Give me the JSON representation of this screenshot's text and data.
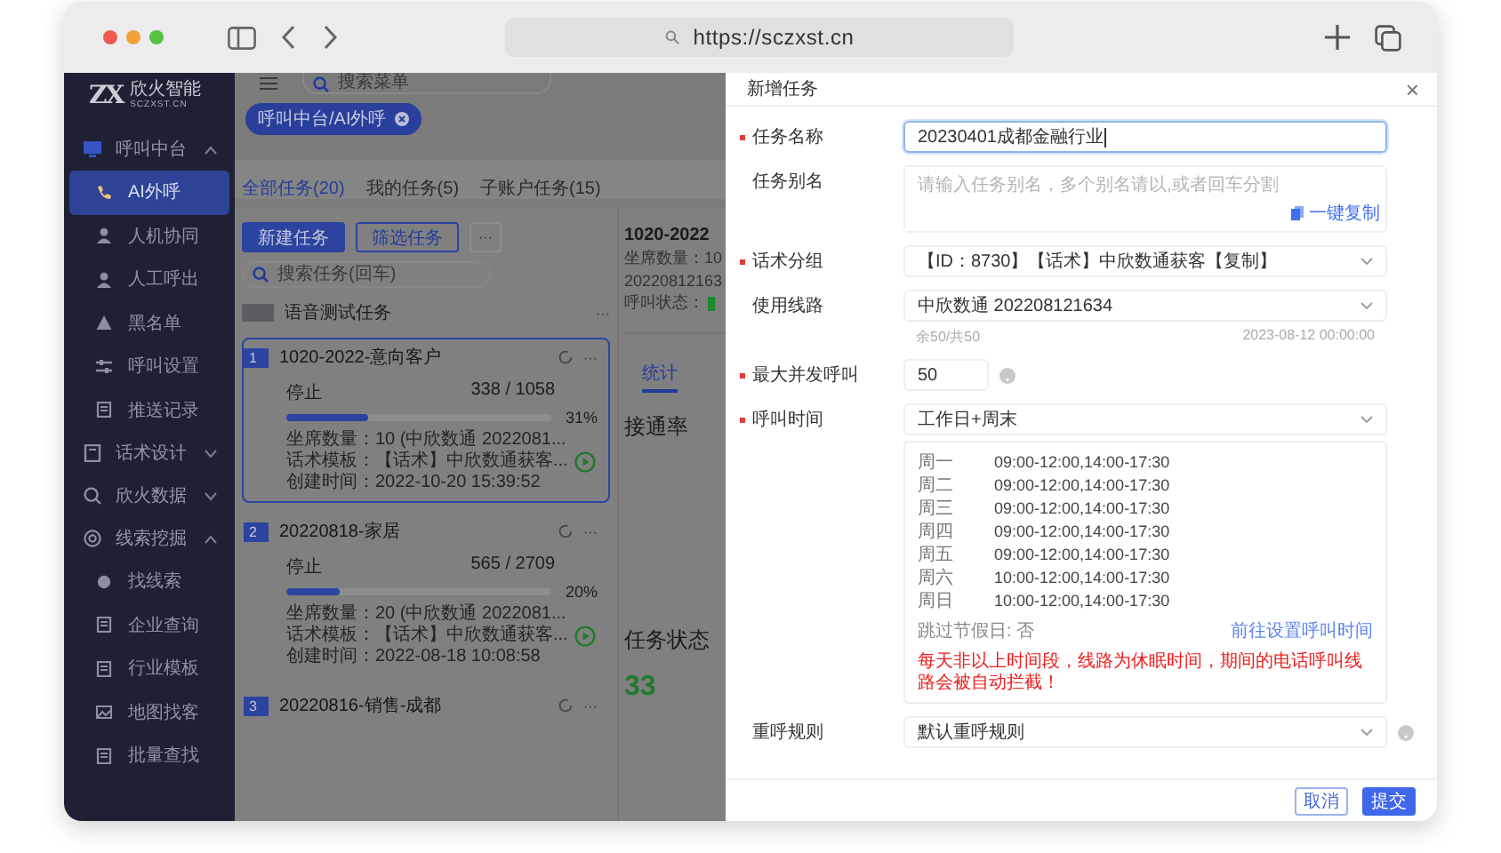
{
  "browser": {
    "url": "https://sczxst.cn"
  },
  "sidebar": {
    "logo": {
      "mark": "ZX",
      "name": "欣火智能",
      "domain": "SCZXST.CN"
    },
    "items": [
      {
        "label": "呼叫中台",
        "expanded": true,
        "children": [
          {
            "label": "AI外呼",
            "selected": true
          },
          {
            "label": "人机协同",
            "selected": false
          },
          {
            "label": "人工呼出",
            "selected": false
          },
          {
            "label": "黑名单",
            "selected": false
          },
          {
            "label": "呼叫设置",
            "selected": false
          },
          {
            "label": "推送记录",
            "selected": false
          }
        ]
      },
      {
        "label": "话术设计",
        "expanded": false
      },
      {
        "label": "欣火数据",
        "expanded": false
      },
      {
        "label": "线索挖掘",
        "expanded": true,
        "children": [
          {
            "label": "找线索",
            "selected": false
          },
          {
            "label": "企业查询",
            "selected": false
          },
          {
            "label": "行业模板",
            "selected": false
          },
          {
            "label": "地图找客",
            "selected": false
          },
          {
            "label": "批量查找",
            "selected": false
          }
        ]
      }
    ]
  },
  "topbar": {
    "search_placeholder": "搜索菜单",
    "breadcrumb_tag": "呼叫中台/AI外呼"
  },
  "tabs": [
    {
      "label": "全部任务(20)",
      "selected": true
    },
    {
      "label": "我的任务(5)",
      "selected": false
    },
    {
      "label": "子账户任务(15)",
      "selected": false
    }
  ],
  "task_list": {
    "new_button": "新建任务",
    "filter_button": "筛选任务",
    "more_button": "···",
    "search_placeholder": "搜索任务(回车)",
    "group": {
      "name": "语音测试任务",
      "more": "···"
    },
    "tasks": [
      {
        "index": "1",
        "name": "1020-2022-意向客户",
        "more": "···",
        "selected": true,
        "status": "停止",
        "count": "338 / 1058",
        "level": 0.31,
        "percent": "31%",
        "seats": "坐席数量：10 (中欣数通 2022081...",
        "script": "话术模板：【话术】中欣数通获客...",
        "created": "创建时间：2022-10-20 15:39:52"
      },
      {
        "index": "2",
        "name": "20220818-家居",
        "more": "···",
        "selected": false,
        "status": "停止",
        "count": "565 / 2709",
        "level": 0.2,
        "percent": "20%",
        "seats": "坐席数量：20 (中欣数通 2022081...",
        "script": "话术模板：【话术】中欣数通获客...",
        "created": "创建时间：2022-08-18 10:08:58"
      },
      {
        "index": "3",
        "name": "20220816-销售-成都",
        "more": "···",
        "selected": false
      }
    ]
  },
  "detail": {
    "title": "1020-2022",
    "seats": "坐席数量：10",
    "line": "20220812163",
    "call_status": "呼叫状态：",
    "tab": "统计",
    "connect_rate": "接通率",
    "task_status": "任务状态",
    "number": "33"
  },
  "dialog": {
    "title": "新增任务",
    "close": "×",
    "fields": [
      {
        "kind": "input",
        "label": "任务名称",
        "required": true,
        "value": "20230401成都金融行业"
      },
      {
        "kind": "textarea",
        "label": "任务别名",
        "required": false,
        "placeholder": "请输入任务别名，多个别名请以,或者回车分割",
        "link": "一键复制"
      },
      {
        "kind": "select",
        "label": "话术分组",
        "required": true,
        "value": "【ID：8730】【话术】中欣数通获客【复制】"
      },
      {
        "kind": "select",
        "label": "使用线路",
        "required": false,
        "value": "中欣数通 202208121634",
        "hint_left": "余50/共50",
        "hint_right": "2023-08-12 00:00:00"
      },
      {
        "kind": "number",
        "label": "最大并发呼叫",
        "required": true,
        "value": "50",
        "help": true
      },
      {
        "kind": "schedule",
        "label": "呼叫时间",
        "required": true,
        "value": "工作日+周末",
        "days": [
          {
            "day": "周一",
            "time": "09:00-12:00,14:00-17:30"
          },
          {
            "day": "周二",
            "time": "09:00-12:00,14:00-17:30"
          },
          {
            "day": "周三",
            "time": "09:00-12:00,14:00-17:30"
          },
          {
            "day": "周四",
            "time": "09:00-12:00,14:00-17:30"
          },
          {
            "day": "周五",
            "time": "09:00-12:00,14:00-17:30"
          },
          {
            "day": "周六",
            "time": "10:00-12:00,14:00-17:30"
          },
          {
            "day": "周日",
            "time": "10:00-12:00,14:00-17:30"
          }
        ],
        "holiday": "跳过节假日: 否",
        "link": "前往设置呼叫时间",
        "warning": "每天非以上时间段，线路为休眠时间，期间的电话呼叫线路会被自动拦截！"
      },
      {
        "kind": "select",
        "label": "重呼规则",
        "required": false,
        "value": "默认重呼规则",
        "help": true
      }
    ],
    "cancel": "取消",
    "submit": "提交"
  }
}
